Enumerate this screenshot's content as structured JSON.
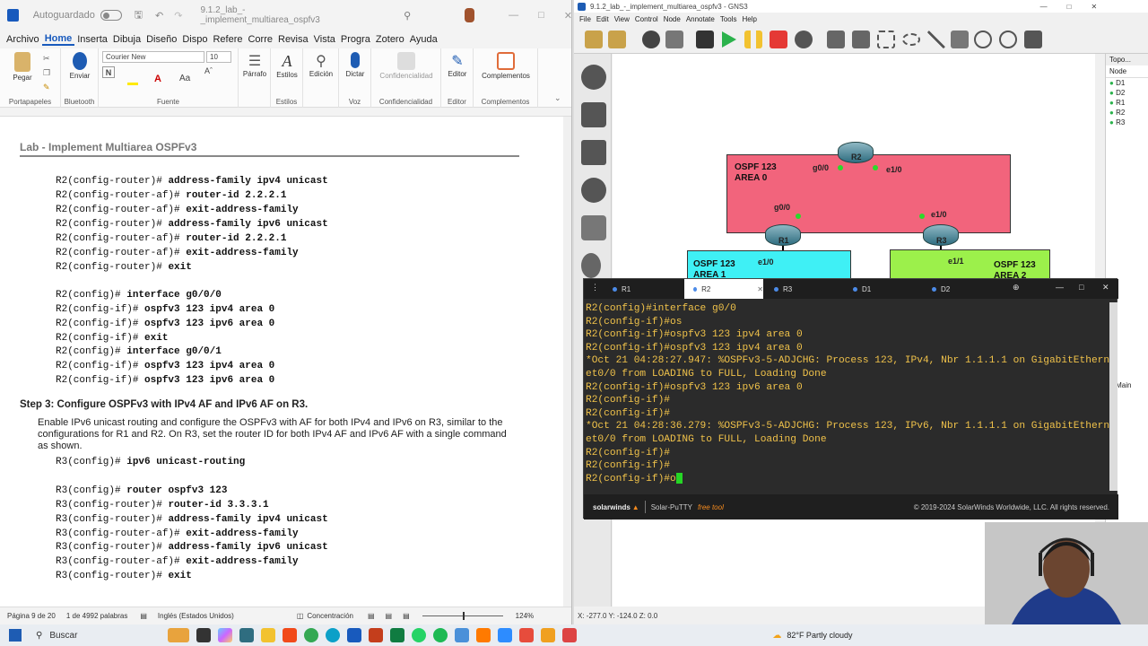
{
  "word": {
    "autosave_label": "Autoguardado",
    "doc_title": "9.1.2_lab_-_implement_multiarea_ospfv3",
    "tabs": [
      "Archivo",
      "Home",
      "Inserta",
      "Dibuja",
      "Diseño",
      "Dispo",
      "Refere",
      "Corre",
      "Revisa",
      "Vista",
      "Progra",
      "Zotero",
      "Ayuda"
    ],
    "active_tab": "Home",
    "font_name": "Courier New",
    "font_size": "10",
    "ribbon": {
      "pegar": "Pegar",
      "enviar": "Enviar",
      "parrafo": "Párrafo",
      "estilos": "Estilos",
      "edicion": "Edición",
      "dictar": "Dictar",
      "confidencialidad": "Confidencialidad",
      "editor": "Editor",
      "complementos": "Complementos",
      "g_portapapeles": "Portapapeles",
      "g_bluetooth": "Bluetooth",
      "g_fuente": "Fuente",
      "g_estilos": "Estilos",
      "g_voz": "Voz",
      "g_confidencialidad": "Confidencialidad",
      "g_editor": "Editor",
      "g_complementos": "Complementos"
    },
    "header_text": "Lab - Implement Multiarea OSPFv3",
    "code_block_1": [
      {
        "prompt": "R2(config-router)#",
        "cmd": "address-family ipv4 unicast"
      },
      {
        "prompt": "R2(config-router-af)#",
        "cmd": "router-id 2.2.2.1"
      },
      {
        "prompt": "R2(config-router-af)#",
        "cmd": "exit-address-family"
      },
      {
        "prompt": "R2(config-router)#",
        "cmd": "address-family ipv6 unicast"
      },
      {
        "prompt": "R2(config-router-af)#",
        "cmd": "router-id 2.2.2.1"
      },
      {
        "prompt": "R2(config-router-af)#",
        "cmd": "exit-address-family"
      },
      {
        "prompt": "R2(config-router)#",
        "cmd": "exit"
      }
    ],
    "code_block_2": [
      {
        "prompt": "R2(config)#",
        "cmd": "interface g0/0/0"
      },
      {
        "prompt": "R2(config-if)#",
        "cmd": "ospfv3 123 ipv4 area 0"
      },
      {
        "prompt": "R2(config-if)#",
        "cmd": "ospfv3 123 ipv6 area 0"
      },
      {
        "prompt": "R2(config-if)#",
        "cmd": "exit"
      },
      {
        "prompt": "R2(config)#",
        "cmd": "interface g0/0/1"
      },
      {
        "prompt": "R2(config-if)#",
        "cmd": "ospfv3 123 ipv4 area 0"
      },
      {
        "prompt": "R2(config-if)#",
        "cmd": "ospfv3 123 ipv6 area 0"
      }
    ],
    "step_heading": "Step 3: Configure OSPFv3 with IPv4 AF and IPv6 AF on R3.",
    "step_para": "Enable IPv6 unicast routing and configure the OSPFv3 with AF for both IPv4 and IPv6 on R3, similar to the configurations for R1 and R2. On R3, set the router ID for both IPv4 AF and IPv6 AF with a single command as shown.",
    "code_block_3": [
      {
        "prompt": "R3(config)#",
        "cmd": "ipv6 unicast-routing"
      }
    ],
    "code_block_4": [
      {
        "prompt": "R3(config)#",
        "cmd": "router ospfv3 123"
      },
      {
        "prompt": "R3(config-router)#",
        "cmd": "router-id 3.3.3.1"
      },
      {
        "prompt": "R3(config-router)#",
        "cmd": "address-family ipv4 unicast"
      },
      {
        "prompt": "R3(config-router-af)#",
        "cmd": "exit-address-family"
      },
      {
        "prompt": "R3(config-router)#",
        "cmd": "address-family ipv6 unicast"
      },
      {
        "prompt": "R3(config-router-af)#",
        "cmd": "exit-address-family"
      },
      {
        "prompt": "R3(config-router)#",
        "cmd": "exit"
      }
    ],
    "status": {
      "page": "Página 9 de 20",
      "words": "1 de 4992 palabras",
      "language": "Inglés (Estados Unidos)",
      "focus": "Concentración",
      "zoom": "124%"
    }
  },
  "gns3": {
    "title": "9.1.2_lab_-_implement_multiarea_ospfv3 - GNS3",
    "menu": [
      "File",
      "Edit",
      "View",
      "Control",
      "Node",
      "Annotate",
      "Tools",
      "Help"
    ],
    "topology_panel_title": "Topo...",
    "node_header": "Node",
    "nodes": [
      "D1",
      "D2",
      "R1",
      "R2",
      "R3"
    ],
    "bottom_panel_item": "Main",
    "status": "X: -277.0 Y: -124.0 Z: 0.0",
    "areas": {
      "a0": [
        "OSPF 123",
        "AREA 0"
      ],
      "a1": [
        "OSPF 123",
        "AREA 1"
      ],
      "a2": [
        "OSPF 123",
        "AREA 2"
      ]
    },
    "routers": {
      "r1": "R1",
      "r2": "R2",
      "r3": "R3"
    },
    "interfaces": {
      "r2_left": "g0/0",
      "r2_right": "e1/0",
      "r1_top": "g0/0",
      "r1_bottom": "e1/0",
      "r3_top": "e1/0",
      "r3_bottom": "e1/1"
    }
  },
  "putty": {
    "tabs": [
      "R1",
      "R2",
      "R3",
      "D1",
      "D2"
    ],
    "active_tab": "R2",
    "lines": [
      "R2(config)#interface g0/0",
      "R2(config-if)#os",
      "R2(config-if)#ospfv3 123 ipv4 area 0",
      "R2(config-if)#ospfv3 123 ipv4 area 0",
      "*Oct 21 04:28:27.947: %OSPFv3-5-ADJCHG: Process 123, IPv4, Nbr 1.1.1.1 on GigabitEthern",
      "et0/0 from LOADING to FULL, Loading Done",
      "R2(config-if)#ospfv3 123 ipv6 area 0",
      "R2(config-if)#",
      "R2(config-if)#",
      "*Oct 21 04:28:36.279: %OSPFv3-5-ADJCHG: Process 123, IPv6, Nbr 1.1.1.1 on GigabitEthern",
      "et0/0 from LOADING to FULL, Loading Done",
      "R2(config-if)#",
      "R2(config-if)#"
    ],
    "current_line": "R2(config-if)#o",
    "brand": "solarwinds",
    "product": "Solar-PuTTY",
    "product_tag": "free tool",
    "copyright": "© 2019-2024 SolarWinds Worldwide, LLC. All rights reserved."
  },
  "taskbar": {
    "search_label": "Buscar",
    "weather": "82°F  Partly cloudy"
  }
}
